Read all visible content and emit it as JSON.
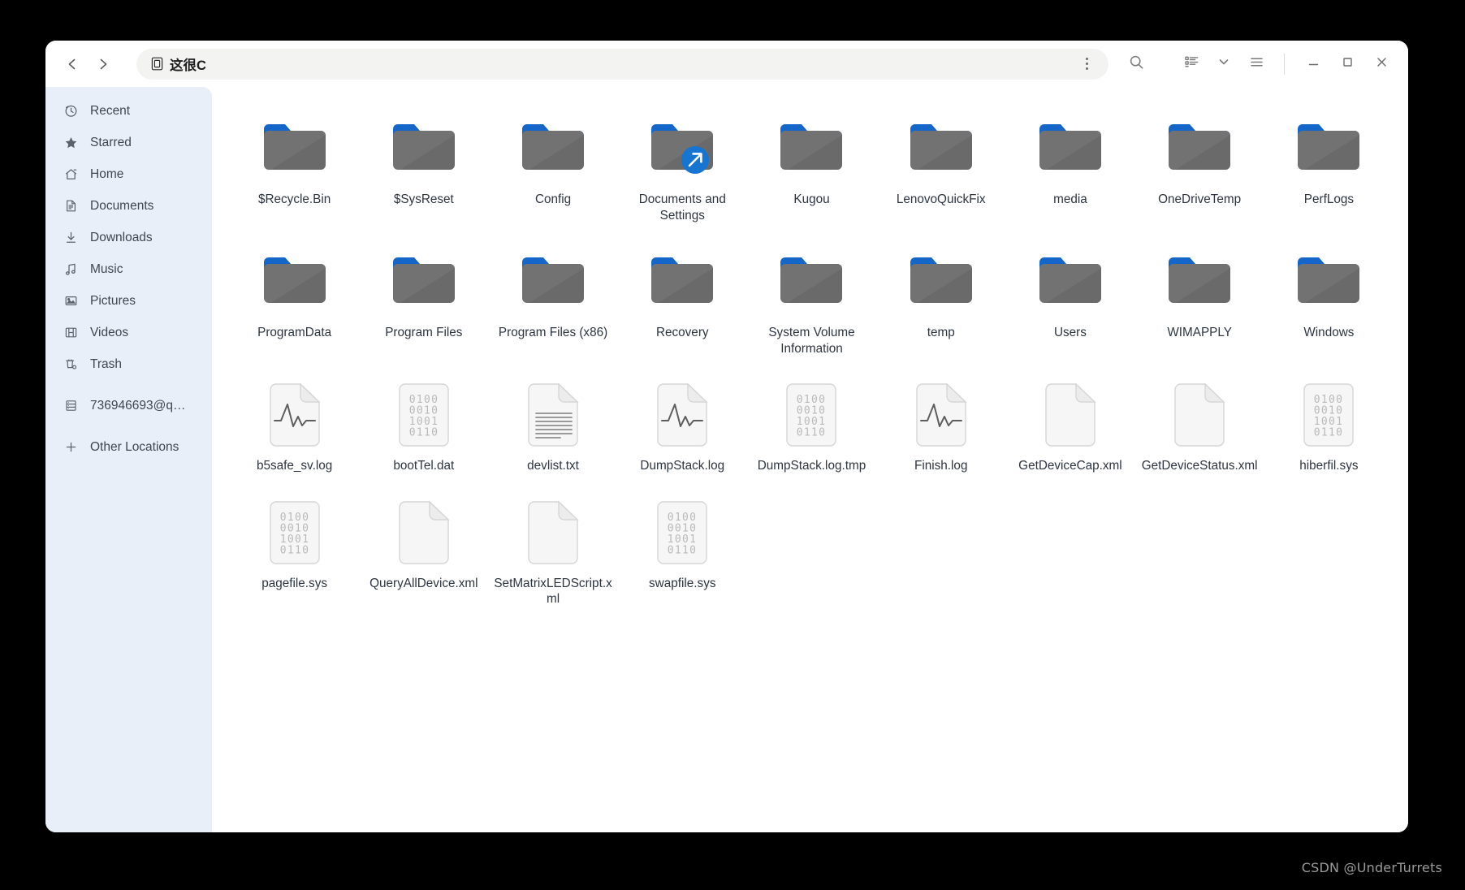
{
  "window": {
    "title": "这很C",
    "title_icon": "drive-icon",
    "nav": {
      "back": "‹",
      "forward": "›"
    },
    "pathbar": {
      "menu_icon": "vertical-dots-icon"
    },
    "toolbar": [
      {
        "name": "search-icon",
        "label": "Search"
      },
      {
        "name": "list-view-icon",
        "label": "List view"
      },
      {
        "name": "chevron-down-icon",
        "label": "View options"
      },
      {
        "name": "hamburger-menu-icon",
        "label": "Main menu"
      }
    ],
    "controls": [
      {
        "name": "minimize-button",
        "label": "Minimize"
      },
      {
        "name": "maximize-button",
        "label": "Maximize"
      },
      {
        "name": "close-button",
        "label": "Close"
      }
    ]
  },
  "sidebar": {
    "items": [
      {
        "label": "Recent",
        "icon": "clock-icon"
      },
      {
        "label": "Starred",
        "icon": "star-icon"
      },
      {
        "label": "Home",
        "icon": "home-icon"
      },
      {
        "label": "Documents",
        "icon": "document-icon"
      },
      {
        "label": "Downloads",
        "icon": "download-icon"
      },
      {
        "label": "Music",
        "icon": "music-note-icon"
      },
      {
        "label": "Pictures",
        "icon": "picture-icon"
      },
      {
        "label": "Videos",
        "icon": "film-icon"
      },
      {
        "label": "Trash",
        "icon": "trash-icon"
      }
    ],
    "devices": [
      {
        "label": "736946693@q…",
        "icon": "drive-stack-icon"
      }
    ],
    "footer": [
      {
        "label": "Other Locations",
        "icon": "plus-icon"
      }
    ]
  },
  "files": [
    {
      "name": "$Recycle.Bin",
      "type": "folder"
    },
    {
      "name": "$SysReset",
      "type": "folder"
    },
    {
      "name": "Config",
      "type": "folder"
    },
    {
      "name": "Documents and Settings",
      "type": "folder-link"
    },
    {
      "name": "Kugou",
      "type": "folder"
    },
    {
      "name": "LenovoQuickFix",
      "type": "folder"
    },
    {
      "name": "media",
      "type": "folder"
    },
    {
      "name": "OneDriveTemp",
      "type": "folder"
    },
    {
      "name": "PerfLogs",
      "type": "folder"
    },
    {
      "name": "ProgramData",
      "type": "folder"
    },
    {
      "name": "Program Files",
      "type": "folder"
    },
    {
      "name": "Program Files (x86)",
      "type": "folder"
    },
    {
      "name": "Recovery",
      "type": "folder"
    },
    {
      "name": "System Volume Information",
      "type": "folder"
    },
    {
      "name": "temp",
      "type": "folder"
    },
    {
      "name": "Users",
      "type": "folder"
    },
    {
      "name": "WIMAPPLY",
      "type": "folder"
    },
    {
      "name": "Windows",
      "type": "folder"
    },
    {
      "name": "b5safe_sv.log",
      "type": "log"
    },
    {
      "name": "bootTel.dat",
      "type": "binary"
    },
    {
      "name": "devlist.txt",
      "type": "text"
    },
    {
      "name": "DumpStack.log",
      "type": "log"
    },
    {
      "name": "DumpStack.log.tmp",
      "type": "binary"
    },
    {
      "name": "Finish.log",
      "type": "log"
    },
    {
      "name": "GetDeviceCap.xml",
      "type": "xml"
    },
    {
      "name": "GetDeviceStatus.xml",
      "type": "xml"
    },
    {
      "name": "hiberfil.sys",
      "type": "binary"
    },
    {
      "name": "pagefile.sys",
      "type": "binary"
    },
    {
      "name": "QueryAllDevice.xml",
      "type": "xml"
    },
    {
      "name": "SetMatrixLEDScript.xml",
      "type": "xml"
    },
    {
      "name": "swapfile.sys",
      "type": "binary"
    }
  ],
  "binary_icon_rows": [
    "0100",
    "0010",
    "1001",
    "0110"
  ],
  "xml_icon_glyph": "</>",
  "watermark": "CSDN @UnderTurrets",
  "colors": {
    "folder_tab": "#1466c8",
    "folder_body": "#6e6e6e",
    "sidebar_bg": "#e8eff8",
    "symlink_badge": "#1675d1",
    "xml_accent": "#e06ec8",
    "window_bg": "#ffffff",
    "page_bg": "#000000"
  }
}
